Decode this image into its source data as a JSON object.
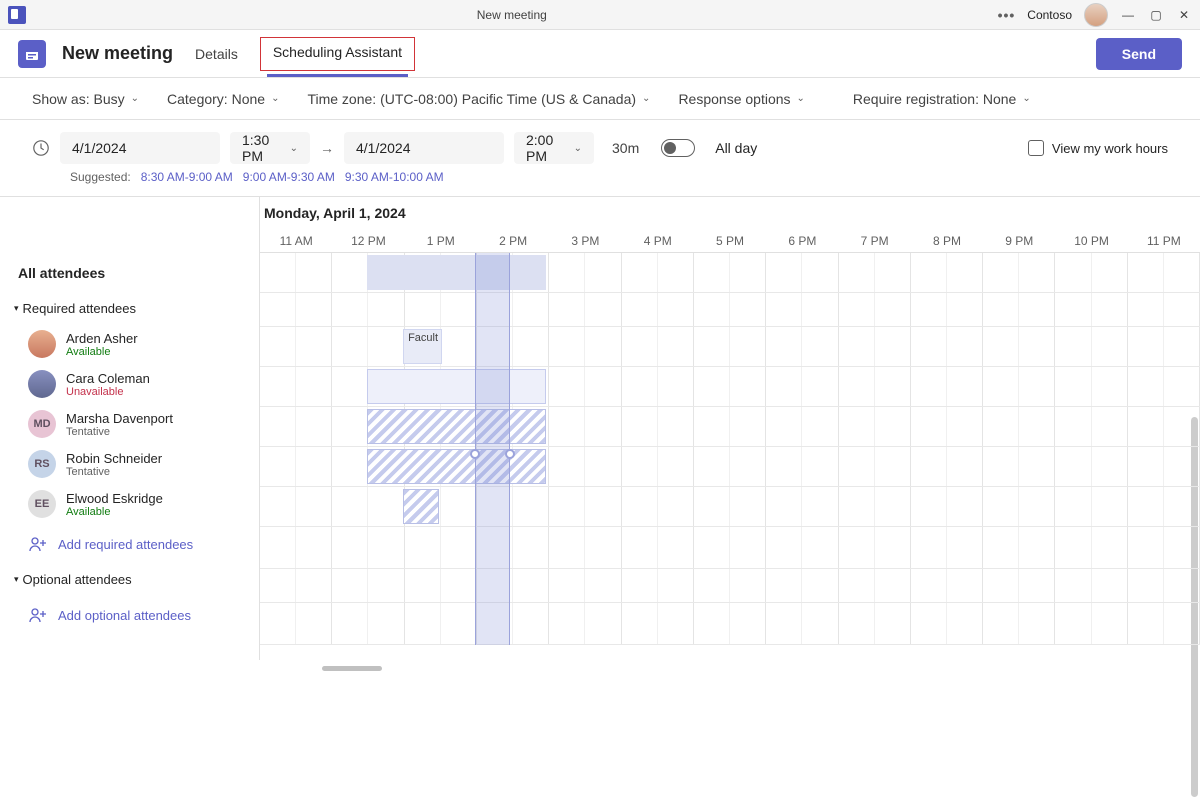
{
  "titlebar": {
    "title": "New meeting",
    "org": "Contoso"
  },
  "header": {
    "page_title": "New meeting",
    "tab_details": "Details",
    "tab_scheduling": "Scheduling Assistant",
    "send": "Send"
  },
  "options": {
    "show_as": "Show as: Busy",
    "category": "Category: None",
    "timezone": "Time zone: (UTC-08:00) Pacific Time (US & Canada)",
    "response": "Response options",
    "registration": "Require registration: None"
  },
  "time": {
    "start_date": "4/1/2024",
    "start_time": "1:30 PM",
    "end_date": "4/1/2024",
    "end_time": "2:00 PM",
    "duration": "30m",
    "all_day": "All day",
    "view_hours": "View my work hours"
  },
  "suggested": {
    "label": "Suggested:",
    "slot1": "8:30 AM-9:00 AM",
    "slot2": "9:00 AM-9:30 AM",
    "slot3": "9:30 AM-10:00 AM"
  },
  "grid": {
    "date": "Monday, April 1, 2024",
    "hours": [
      "11 AM",
      "12 PM",
      "1 PM",
      "2 PM",
      "3 PM",
      "4 PM",
      "5 PM",
      "6 PM",
      "7 PM",
      "8 PM",
      "9 PM",
      "10 PM",
      "11 PM"
    ]
  },
  "sidebar": {
    "all_attendees": "All attendees",
    "required_hdr": "Required attendees",
    "optional_hdr": "Optional attendees",
    "add_required": "Add required attendees",
    "add_optional": "Add optional attendees",
    "attendees": [
      {
        "name": "Arden Asher",
        "status": "Available",
        "status_class": "available",
        "initials": "",
        "color": "img"
      },
      {
        "name": "Cara Coleman",
        "status": "Unavailable",
        "status_class": "unavailable",
        "initials": "",
        "color": "img2"
      },
      {
        "name": "Marsha Davenport",
        "status": "Tentative",
        "status_class": "tentative",
        "initials": "MD",
        "color": "#e8c4d4"
      },
      {
        "name": "Robin Schneider",
        "status": "Tentative",
        "status_class": "tentative",
        "initials": "RS",
        "color": "#c5d4e8"
      },
      {
        "name": "Elwood Eskridge",
        "status": "Available",
        "status_class": "available",
        "initials": "EE",
        "color": "#e0e0e0"
      }
    ]
  },
  "event": {
    "label": "Facult"
  }
}
